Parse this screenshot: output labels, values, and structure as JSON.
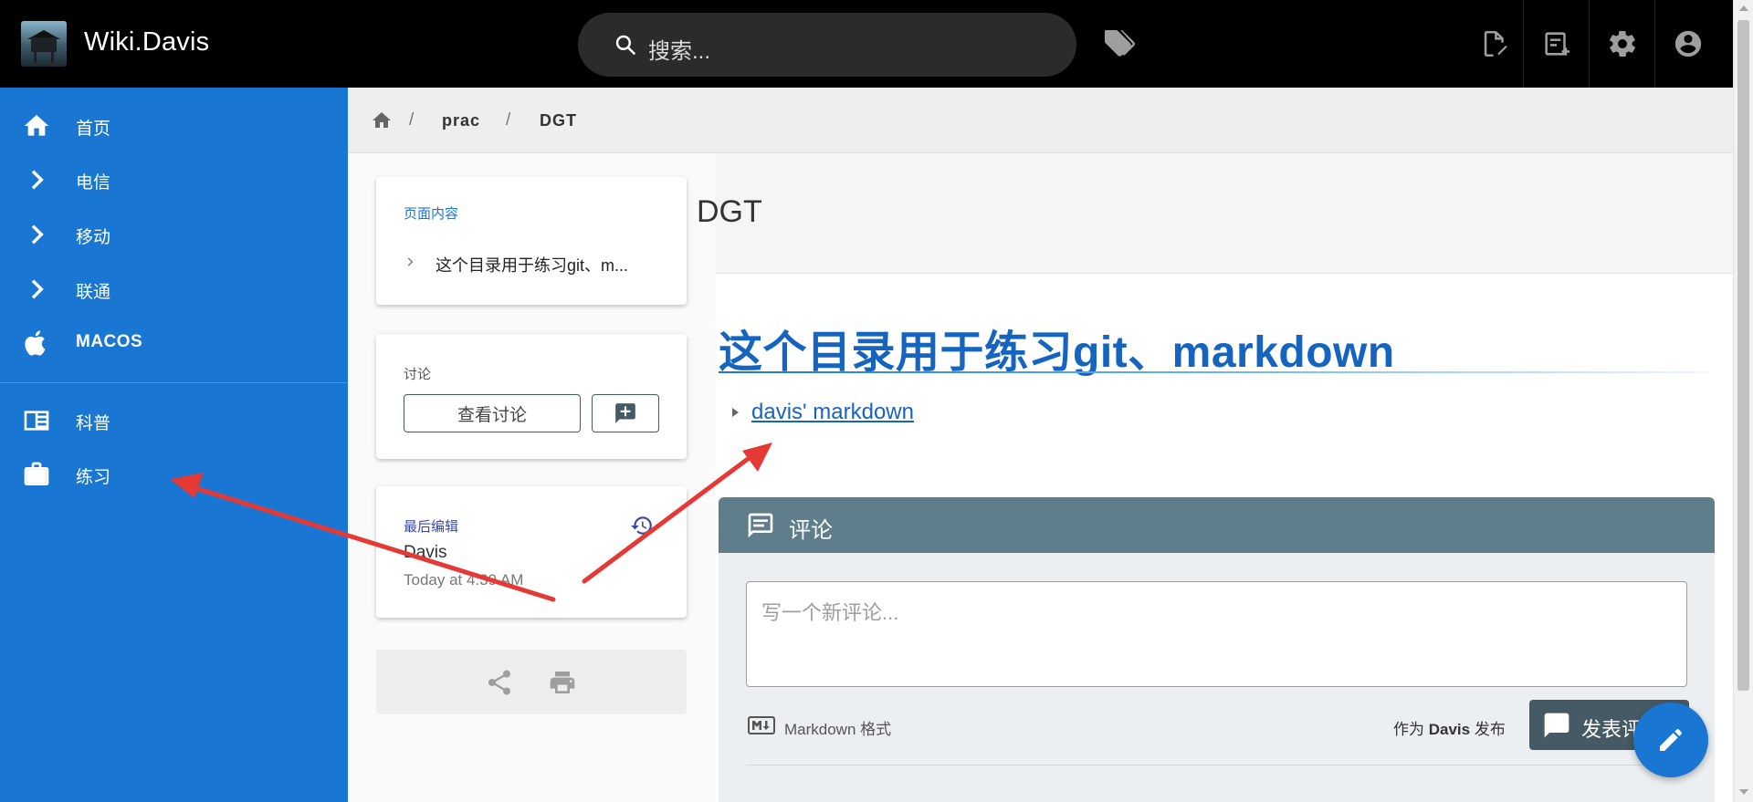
{
  "header": {
    "site_title": "Wiki.Davis",
    "search_placeholder": "搜索..."
  },
  "sidebar": {
    "items": [
      {
        "label": "首页",
        "icon": "home-icon"
      },
      {
        "label": "电信",
        "icon": "chevron-right-icon"
      },
      {
        "label": "移动",
        "icon": "chevron-right-icon"
      },
      {
        "label": "联通",
        "icon": "chevron-right-icon"
      },
      {
        "label": "MACOS",
        "icon": "apple-icon"
      },
      {
        "label": "科普",
        "icon": "newspaper-icon"
      },
      {
        "label": "练习",
        "icon": "briefcase-icon"
      }
    ]
  },
  "breadcrumb": {
    "items": [
      "prac",
      "DGT"
    ],
    "separator": "/"
  },
  "toc": {
    "title": "页面内容",
    "item": "这个目录用于练习git、m..."
  },
  "discussion": {
    "title": "讨论",
    "view_label": "查看讨论"
  },
  "last_edit": {
    "title": "最后编辑",
    "author": "Davis",
    "time": "Today at 4:39 AM"
  },
  "page": {
    "title": "DGT",
    "heading": "这个目录用于练习git、markdown",
    "link": "davis' markdown"
  },
  "comments": {
    "title": "评论",
    "placeholder": "写一个新评论...",
    "markdown_label": "Markdown 格式",
    "post_as_prefix": "作为",
    "post_as_user": "Davis",
    "post_as_suffix": "发布",
    "post_button": "发表评论"
  },
  "colors": {
    "header_bg": "#000000",
    "sidebar_bg": "#1976d2",
    "accent": "#1565c0",
    "comments_header": "#607d8b",
    "fab": "#1976d2",
    "annotation_arrow": "#e53935"
  }
}
